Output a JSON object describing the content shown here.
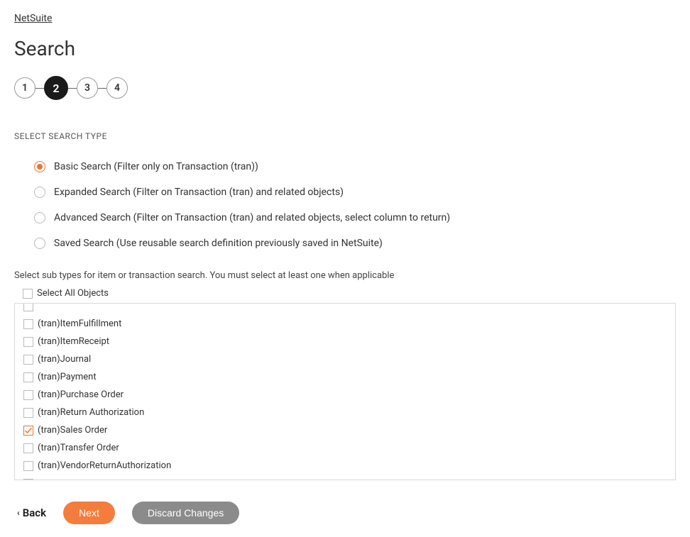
{
  "breadcrumb": {
    "label": "NetSuite"
  },
  "page": {
    "title": "Search"
  },
  "stepper": {
    "steps": [
      "1",
      "2",
      "3",
      "4"
    ],
    "active_index": 1
  },
  "search_type": {
    "section_label": "SELECT SEARCH TYPE",
    "options": [
      {
        "label": "Basic Search (Filter only on Transaction (tran))",
        "selected": true
      },
      {
        "label": "Expanded Search (Filter on Transaction (tran) and related objects)",
        "selected": false
      },
      {
        "label": "Advanced Search (Filter on Transaction (tran) and related objects, select column to return)",
        "selected": false
      },
      {
        "label": "Saved Search (Use reusable search definition previously saved in NetSuite)",
        "selected": false
      }
    ]
  },
  "subtypes": {
    "hint": "Select sub types for item or transaction search. You must select at least one when applicable",
    "select_all_label": "Select All Objects",
    "select_all_checked": false,
    "items": [
      {
        "label": "(tran)ItemFulfillment",
        "checked": false
      },
      {
        "label": "(tran)ItemReceipt",
        "checked": false
      },
      {
        "label": "(tran)Journal",
        "checked": false
      },
      {
        "label": "(tran)Payment",
        "checked": false
      },
      {
        "label": "(tran)Purchase Order",
        "checked": false
      },
      {
        "label": "(tran)Return Authorization",
        "checked": false
      },
      {
        "label": "(tran)Sales Order",
        "checked": true
      },
      {
        "label": "(tran)Transfer Order",
        "checked": false
      },
      {
        "label": "(tran)VendorReturnAuthorization",
        "checked": false
      }
    ]
  },
  "footer": {
    "back_label": "Back",
    "next_label": "Next",
    "discard_label": "Discard Changes"
  },
  "colors": {
    "accent": "#e8762d",
    "primary_button": "#f47c3c",
    "secondary_button": "#8b8b8b"
  }
}
